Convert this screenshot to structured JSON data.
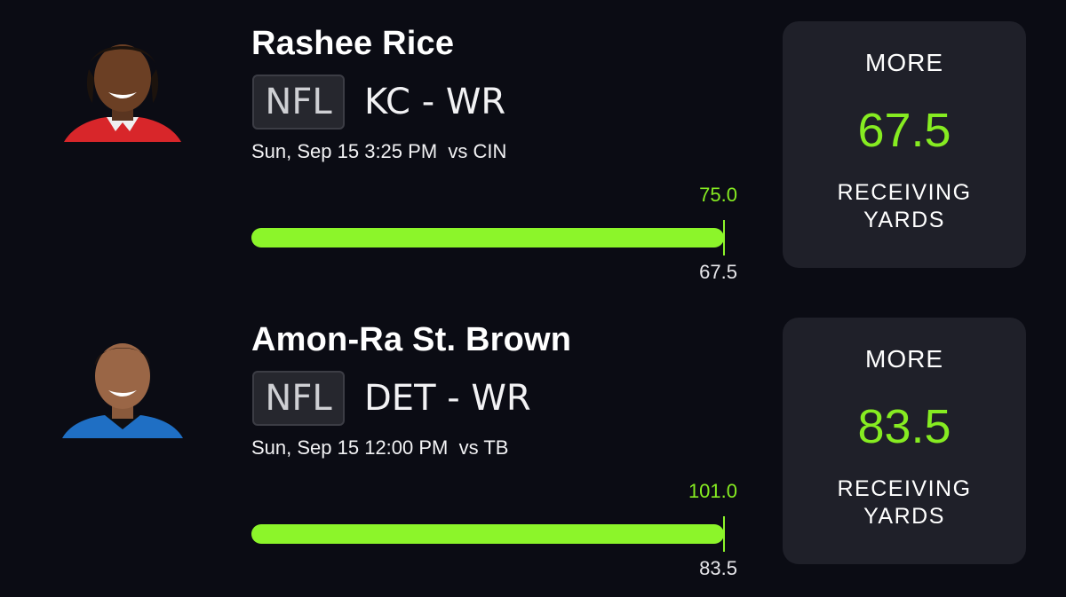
{
  "picks": [
    {
      "player_name": "Rashee Rice",
      "league": "NFL",
      "team_position": "KC - WR",
      "game_info": "Sun, Sep 15 3:25 PM  vs CIN",
      "jersey_color": "#d8262a",
      "progress": {
        "high_label": "75.0",
        "line_label": "67.5",
        "fill_fraction": 1.0
      },
      "card": {
        "pick_label": "MORE",
        "line_value": "67.5",
        "stat_line1": "RECEIVING",
        "stat_line2": "YARDS"
      }
    },
    {
      "player_name": "Amon-Ra St. Brown",
      "league": "NFL",
      "team_position": "DET - WR",
      "game_info": "Sun, Sep 15 12:00 PM  vs TB",
      "jersey_color": "#1f6fc4",
      "progress": {
        "high_label": "101.0",
        "line_label": "83.5",
        "fill_fraction": 1.0
      },
      "card": {
        "pick_label": "MORE",
        "line_value": "83.5",
        "stat_line1": "RECEIVING",
        "stat_line2": "YARDS"
      }
    }
  ],
  "colors": {
    "background": "#0b0c14",
    "accent_green": "#86ec21",
    "card_bg": "#1f2029"
  }
}
